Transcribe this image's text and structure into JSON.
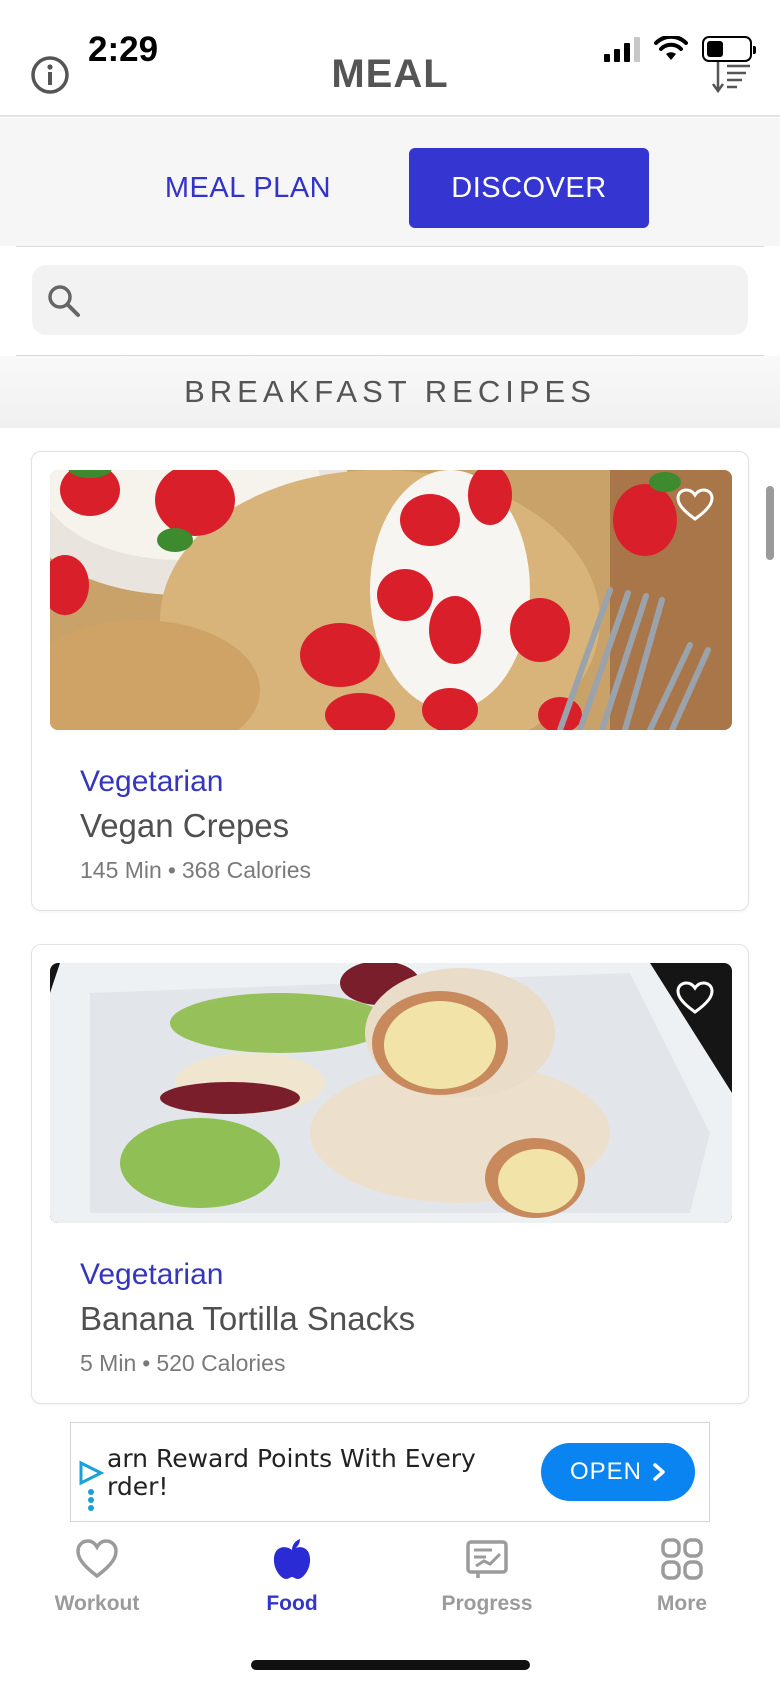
{
  "status_bar": {
    "time": "2:29"
  },
  "header": {
    "title": "MEAL"
  },
  "tabs": [
    {
      "label": "MEAL PLAN",
      "active": false
    },
    {
      "label": "DISCOVER",
      "active": true
    }
  ],
  "search": {
    "placeholder": "",
    "value": ""
  },
  "section": {
    "title": "BREAKFAST RECIPES"
  },
  "recipes": [
    {
      "category": "Vegetarian",
      "title": "Vegan Crepes",
      "minutes": "145 Min",
      "calories": "368 Calories",
      "separator": "•",
      "favorite": false,
      "image": "crepes-with-strawberries"
    },
    {
      "category": "Vegetarian",
      "title": "Banana Tortilla Snacks",
      "minutes": "5 Min",
      "calories": "520 Calories",
      "separator": "•",
      "favorite": false,
      "image": "banana-tortilla-with-apple-slices"
    }
  ],
  "ad": {
    "text": "arn Reward Points With Every\nrder!",
    "button_label": "OPEN"
  },
  "bottom_nav": [
    {
      "label": "Workout",
      "icon": "heart-icon",
      "active": false
    },
    {
      "label": "Food",
      "icon": "apple-icon",
      "active": true
    },
    {
      "label": "Progress",
      "icon": "chart-icon",
      "active": false
    },
    {
      "label": "More",
      "icon": "grid-icon",
      "active": false
    }
  ],
  "colors": {
    "accent": "#3535d2",
    "ad_button": "#0a84f0",
    "muted": "#9b9b9b"
  }
}
